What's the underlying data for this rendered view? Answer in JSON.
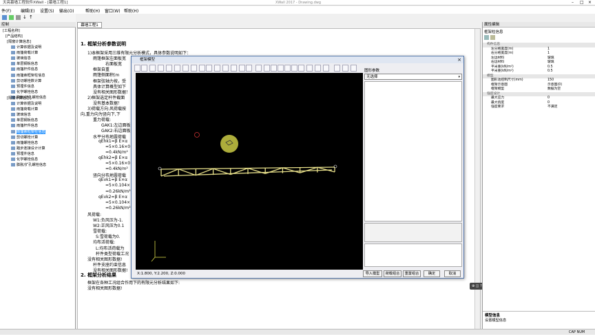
{
  "titlebar": {
    "title": "天亮幕墙工程软件XWall - [幕墙工程1]",
    "center": "XWall 2017 - Drawing.dwg"
  },
  "menu": [
    "件(F)",
    "编辑(E)",
    "设置(S)",
    "输出(O)",
    "帮助(H)",
    "窗口(W)",
    "帮助(H)"
  ],
  "left": {
    "header": "控制",
    "root": "[工程名称]",
    "product": "[产品结构]",
    "group1": "[隔窗计算信息]",
    "items1": [
      "计算依据及说明",
      "雨篷荷载计算",
      "玻璃信息",
      "单层钢板信息",
      "雨篷杆件信息",
      "雨篷索框架柱信息",
      "剪切螺栓数计算",
      "预埋件信息",
      "化学螺栓信息",
      "膨胀/扩孔螺栓信息"
    ],
    "group2": "[隔窗计算信息]",
    "items2": [
      "计算依据及说明",
      "雨篷荷载计算",
      "玻璃信息",
      "单层钢板信息",
      "雨篷杆件信息",
      "雨篷索框架柱信息",
      "剪切螺栓计算",
      "雨篷螺栓信息",
      "踏步连接设计计算",
      "预埋件信息",
      "化学螺栓信息",
      "膨胀/扩孔螺栓信息"
    ],
    "selected_item": "雨篷索框架柱信息"
  },
  "doc": {
    "tab": "幕墙工程1",
    "heading1": "1. 框架分析参数说明",
    "lines": [
      "1)本框架采用三维有限元分析模式，具体参数说明如下：",
      "雨篷框架左面板宽",
      "右面板宽",
      "框架自重",
      "雨篷侧面积(m",
      "框架弦轴力按，受",
      "具体计算概型如下",
      "没有相关图形数据！",
      "2)框架选定杆件截面",
      "没有基本数据！",
      "3)荷载方向:风荷载按",
      "向,重力向为竖向下,下",
      "重力荷载:",
      "GAK1:左边面板",
      "GAK2:右边面板",
      "水平分布地震荷载",
      "qEhk1=β E×α",
      "=5×0.16×0",
      "=0.4kN/m²",
      "qEhk2=β E×α",
      "=5×0.16×0",
      "=0.4kN/m²",
      "竖向分布地震荷载",
      "qEvk1=β E×α",
      "=5×0.104×",
      "=0.26kN/m²",
      "qEvk2=β E×α",
      "=5×0.104×",
      "=0.26kN/m²",
      "风荷载:",
      "W1:负风压为-1.",
      "W2:正风压为0.1",
      "雪荷载:",
      "S:雪荷载为0.",
      "均布活荷载:",
      "L:均布活荷载为",
      "杆件类型荷载工况",
      "没有相关图形数据!",
      "杆件支座约束信息",
      "没有相关图形数据!"
    ],
    "heading2": "2. 框架分析结果",
    "result_lines": [
      "框架在各种工况组合作用下的有限元分析结果如下:",
      "没有相关图形数据!"
    ]
  },
  "dialog": {
    "title": "框架模型",
    "close": "×",
    "param_label": "图形参数",
    "param_value": "无选择",
    "coords": "X:1.800, Y:2.200, Z:0.000",
    "buttons": [
      "导入模型",
      "荷载组合",
      "重置组合",
      "确定",
      "取消"
    ],
    "truss_color": "#e8e08a",
    "background_color": "#000000"
  },
  "right": {
    "header": "属性编辑",
    "subheader": "框架柱信息",
    "groups": [
      {
        "name": "构件信息",
        "rows": [
          [
            "左分格宽度(m)",
            "1"
          ],
          [
            "右分格宽度(m)",
            "1"
          ],
          [
            "左边材料",
            "玻璃"
          ],
          [
            "右边材料",
            "玻璃"
          ],
          [
            "平米重(kN/m²)",
            "0.5"
          ],
          [
            "平米重(kN/m²)",
            "0.5"
          ]
        ]
      },
      {
        "name": "模型",
        "rows": [
          [
            "图形池控制尺寸(mm)",
            "150"
          ],
          [
            "框架示意图",
            "示意图(0)"
          ],
          [
            "框架模型",
            "数据为空"
          ]
        ]
      },
      {
        "name": "强度设计",
        "rows": [
          [
            "最大应力",
            "0"
          ],
          [
            "最大挠度",
            "0"
          ],
          [
            "强度要求",
            "不满足"
          ]
        ]
      }
    ],
    "bottom_title": "模型信息",
    "bottom_text": "设置模型信息"
  },
  "status": {
    "right": "CAP  NUM"
  }
}
